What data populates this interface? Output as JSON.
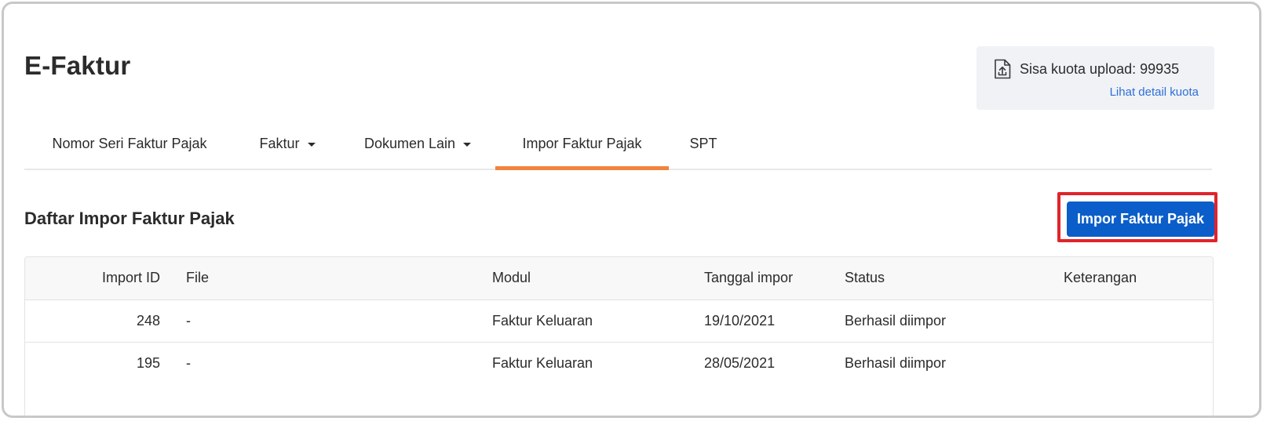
{
  "header": {
    "title": "E-Faktur"
  },
  "quota": {
    "label": "Sisa kuota upload: 99935",
    "link": "Lihat detail kuota",
    "icon": "file-upload-icon"
  },
  "tabs": [
    {
      "label": "Nomor Seri Faktur Pajak",
      "dropdown": false,
      "active": false
    },
    {
      "label": "Faktur",
      "dropdown": true,
      "active": false
    },
    {
      "label": "Dokumen Lain",
      "dropdown": true,
      "active": false
    },
    {
      "label": "Impor Faktur Pajak",
      "dropdown": false,
      "active": true
    },
    {
      "label": "SPT",
      "dropdown": false,
      "active": false
    }
  ],
  "section": {
    "title": "Daftar Impor Faktur Pajak",
    "action_label": "Impor Faktur Pajak"
  },
  "table": {
    "columns": [
      "Import ID",
      "File",
      "Modul",
      "Tanggal impor",
      "Status",
      "Keterangan"
    ],
    "rows": [
      [
        "248",
        "-",
        "Faktur Keluaran",
        "19/10/2021",
        "Berhasil diimpor",
        ""
      ],
      [
        "195",
        "-",
        "Faktur Keluaran",
        "28/05/2021",
        "Berhasil diimpor",
        ""
      ]
    ]
  },
  "colors": {
    "accent": "#f0843c",
    "primary": "#0b5ec9",
    "highlight": "#e0242c",
    "link": "#2e6fd6"
  }
}
